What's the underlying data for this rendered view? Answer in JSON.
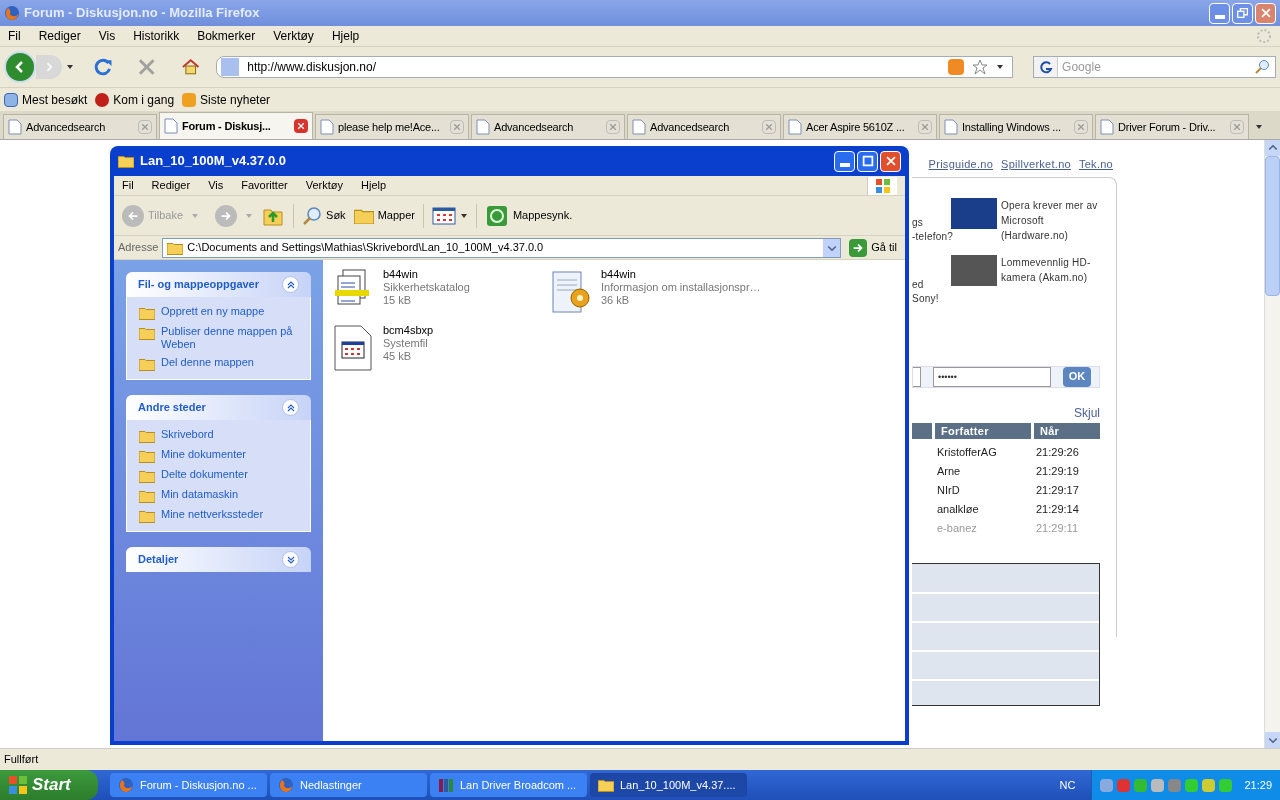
{
  "firefox": {
    "title": "Forum - Diskusjon.no - Mozilla Firefox",
    "menu": [
      "Fil",
      "Rediger",
      "Vis",
      "Historikk",
      "Bokmerker",
      "Verktøy",
      "Hjelp"
    ],
    "url": "http://www.diskusjon.no/",
    "search": {
      "placeholder": "Google"
    },
    "bookmarks": [
      "Mest besøkt",
      "Kom i gang",
      "Siste nyheter"
    ],
    "tabs": [
      {
        "label": "Advancedsearch",
        "selected": false
      },
      {
        "label": "Forum - Diskusj...",
        "selected": true
      },
      {
        "label": "please help me!Ace...",
        "selected": false
      },
      {
        "label": "Advancedsearch",
        "selected": false
      },
      {
        "label": "Advancedsearch",
        "selected": false
      },
      {
        "label": "Acer Aspire 5610Z ...",
        "selected": false
      },
      {
        "label": "Installing Windows ...",
        "selected": false
      },
      {
        "label": "Driver Forum - Driv...",
        "selected": false
      }
    ],
    "status": "Fullført"
  },
  "page": {
    "links": [
      "Prisguide.no",
      "Spillverket.no",
      "Tek.no"
    ],
    "fragments": [
      [
        "gs",
        "-telefon?"
      ],
      [
        "ed",
        "Sony!"
      ]
    ],
    "news": [
      "Opera krever mer av Microsoft (Hardware.no)",
      "Lommevennlig HD-kamera (Akam.no)"
    ],
    "password": "••••••",
    "ok": "OK",
    "hide": "Skjul",
    "columns": [
      "Forfatter",
      "Når"
    ],
    "rows": [
      {
        "author": "KristofferAG",
        "time": "21:29:26",
        "faded": false
      },
      {
        "author": "Arne",
        "time": "21:29:19",
        "faded": false
      },
      {
        "author": "NIrD",
        "time": "21:29:17",
        "faded": false
      },
      {
        "author": "analkløe",
        "time": "21:29:14",
        "faded": false
      },
      {
        "author": "e-banez",
        "time": "21:29:11",
        "faded": true
      }
    ]
  },
  "explorer": {
    "title": "Lan_10_100M_v4.37.0.0",
    "menu": [
      "Fil",
      "Rediger",
      "Vis",
      "Favoritter",
      "Verktøy",
      "Hjelp"
    ],
    "toolbar": {
      "back": "Tilbake",
      "search": "Søk",
      "folders": "Mapper",
      "sync": "Mappesynk."
    },
    "address_label": "Adresse",
    "address": "C:\\Documents and Settings\\Mathias\\Skrivebord\\Lan_10_100M_v4.37.0.0",
    "go": "Gå til",
    "panels": [
      {
        "title": "Fil- og mappeoppgaver",
        "expanded": true,
        "items": [
          "Opprett en ny mappe",
          "Publiser denne mappen på Weben",
          "Del denne mappen"
        ]
      },
      {
        "title": "Andre steder",
        "expanded": true,
        "items": [
          "Skrivebord",
          "Mine dokumenter",
          "Delte dokumenter",
          "Min datamaskin",
          "Mine nettverkssteder"
        ]
      },
      {
        "title": "Detaljer",
        "expanded": false
      }
    ],
    "files": [
      {
        "kind": "catalog",
        "name": "b44win",
        "type": "Sikkerhetskatalog",
        "size": "15 kB"
      },
      {
        "kind": "setup",
        "name": "b44win",
        "type": "Informasjon om installasjonspr…",
        "size": "36 kB"
      },
      {
        "kind": "system",
        "name": "bcm4sbxp",
        "type": "Systemfil",
        "size": "45 kB"
      }
    ]
  },
  "taskbar": {
    "start": "Start",
    "tasks": [
      {
        "label": "Forum - Diskusjon.no ...",
        "selected": false,
        "kind": "firefox"
      },
      {
        "label": "Nedlastinger",
        "selected": false,
        "kind": "firefox"
      },
      {
        "label": "Lan Driver Broadcom ...",
        "selected": false,
        "kind": "archive"
      },
      {
        "label": "Lan_10_100M_v4.37....",
        "selected": true,
        "kind": "folder"
      }
    ],
    "lang": "NC",
    "clock": "21:29"
  }
}
